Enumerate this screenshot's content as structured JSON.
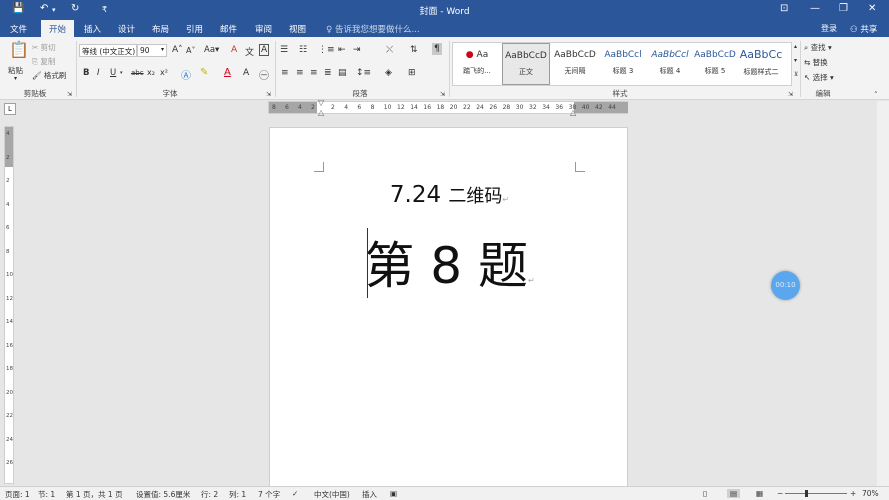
{
  "window": {
    "title": "封面 - Word",
    "qat_save_icon": "save-icon",
    "qat_undo_icon": "undo-icon",
    "qat_redo_icon": "redo-icon",
    "qat_customize_icon": "customize-icon"
  },
  "tabs": [
    "文件",
    "开始",
    "插入",
    "设计",
    "布局",
    "引用",
    "邮件",
    "审阅",
    "视图"
  ],
  "active_tab": "开始",
  "tell_me": "告诉我您想要做什么...",
  "login": "登录",
  "share": "共享",
  "clipboard": {
    "paste": "粘贴",
    "cut": "剪切",
    "copy": "复制",
    "format_painter": "格式刷",
    "group": "剪贴板"
  },
  "font": {
    "name": "等线 (中文正文)",
    "size": "90",
    "group": "字体",
    "bold": "B",
    "italic": "I",
    "underline": "U",
    "strike": "abc",
    "subscript": "x₂",
    "superscript": "x²",
    "grow": "A",
    "shrink": "A",
    "change_case": "Aa",
    "clear": "A",
    "phonetic": "文",
    "border_char": "A"
  },
  "paragraph": {
    "group": "段落"
  },
  "styles": {
    "group": "样式",
    "items": [
      {
        "preview": "Aa",
        "name": "踏飞的..."
      },
      {
        "preview": "AaBbCcD",
        "name": "正文"
      },
      {
        "preview": "AaBbCcD",
        "name": "无间隔"
      },
      {
        "preview": "AaBbCcl",
        "name": "标题 3"
      },
      {
        "preview": "AaBbCcl",
        "name": "标题 4"
      },
      {
        "preview": "AaBbCcD",
        "name": "标题 5"
      },
      {
        "preview": "AaBbCc",
        "name": "标题样式二"
      }
    ],
    "selected": "正文"
  },
  "editing": {
    "group": "编辑",
    "find": "查找",
    "replace": "替换",
    "select": "选择"
  },
  "ruler": {
    "corner": "L",
    "h_left": [
      "8",
      "6",
      "4",
      "2"
    ],
    "h_right": [
      "2",
      "4",
      "6",
      "8",
      "10",
      "12",
      "14",
      "16",
      "18",
      "20",
      "22",
      "24",
      "26",
      "28",
      "30",
      "32",
      "34",
      "36",
      "38",
      "40",
      "42",
      "44"
    ],
    "v": [
      "4",
      "2",
      "2",
      "4",
      "6",
      "8",
      "10",
      "12",
      "14",
      "16",
      "18",
      "20",
      "22",
      "24",
      "26"
    ]
  },
  "document": {
    "line1_num": "7.24",
    "line1_cn": "二维码",
    "line2": "第 8 题",
    "para_mark": "↵"
  },
  "timer": "00:10",
  "status": {
    "page": "页面: 1",
    "section": "节: 1",
    "pages": "第 1 页，共 1 页",
    "position": "设置值: 5.6厘米",
    "row": "行: 2",
    "col": "列: 1",
    "words": "7 个字",
    "language": "中文(中国)",
    "insert": "插入",
    "zoom": "70%",
    "zoom_fraction": 0.7
  }
}
